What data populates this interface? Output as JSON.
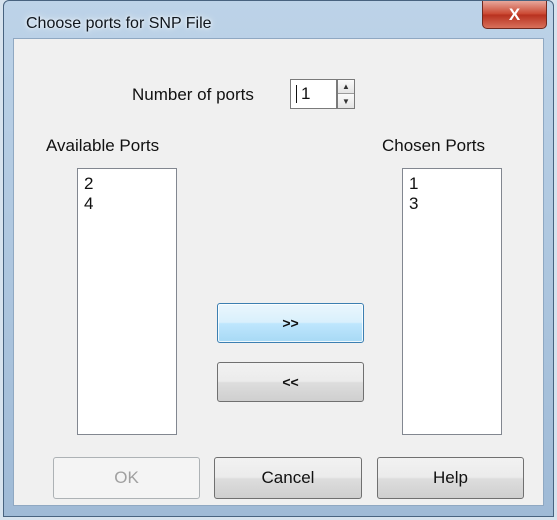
{
  "window": {
    "title": "Choose ports for SNP File",
    "close_label": "X"
  },
  "number_of_ports": {
    "label": "Number of ports",
    "value": "1"
  },
  "available_ports": {
    "heading": "Available Ports",
    "items": [
      "2",
      "4"
    ]
  },
  "chosen_ports": {
    "heading": "Chosen Ports",
    "items": [
      "1",
      "3"
    ]
  },
  "buttons": {
    "add": ">>",
    "remove": "<<",
    "ok": "OK",
    "cancel": "Cancel",
    "help": "Help"
  },
  "icons": {
    "spin_up": "spin-up-arrow-icon",
    "spin_down": "spin-down-arrow-icon",
    "close": "close-icon"
  },
  "colors": {
    "title_bar": "#9fbad6",
    "close_button": "#c9442e",
    "dialog_background": "#f0f0f0",
    "focused_button": "#bee6fd"
  }
}
